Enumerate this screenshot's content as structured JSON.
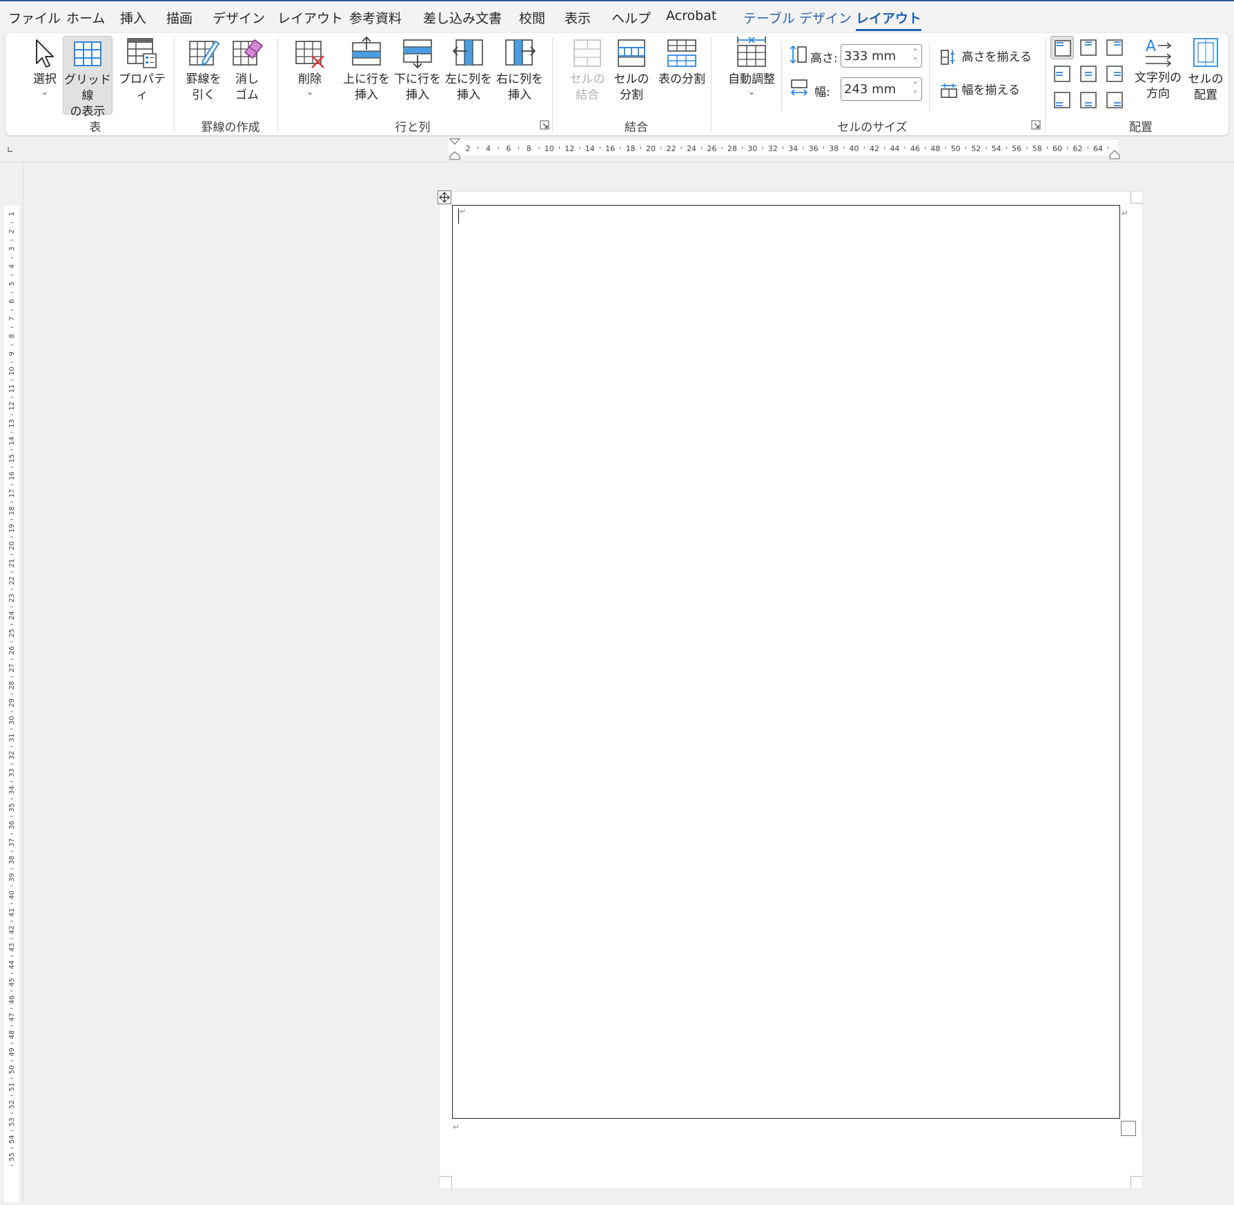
{
  "menu_tabs": [
    "ファイル",
    "ホーム",
    "挿入",
    "描画",
    "デザイン",
    "レイアウト",
    "参考資料",
    "差し込み文書",
    "校閲",
    "表示",
    "ヘルプ",
    "Acrobat",
    "テーブル デザイン",
    "レイアウト"
  ],
  "active_tab": "レイアウト",
  "groups": {
    "table": {
      "label": "表",
      "select": "選択",
      "gridlines": "グリッド線\nの表示",
      "properties": "プロパティ"
    },
    "draw": {
      "label": "罫線の作成",
      "draw_table": "罫線を\n引く",
      "eraser": "消し\nゴム"
    },
    "rows_cols": {
      "label": "行と列",
      "delete": "削除",
      "insert_above": "上に行を\n挿入",
      "insert_below": "下に行を\n挿入",
      "insert_left": "左に列を\n挿入",
      "insert_right": "右に列を\n挿入"
    },
    "merge": {
      "label": "結合",
      "merge_cells": "セルの\n結合",
      "split_cells": "セルの\n分割",
      "split_table": "表の分割"
    },
    "cell_size": {
      "label": "セルのサイズ",
      "autofit": "自動調整",
      "height_label": "高さ:",
      "height_value": "333 mm",
      "width_label": "幅:",
      "width_value": "243 mm",
      "distribute_rows": "高さを揃える",
      "distribute_cols": "幅を揃える"
    },
    "alignment": {
      "label": "配置",
      "text_direction": "文字列の\n方向",
      "cell_margins": "セルの\n配置"
    }
  },
  "colors": {
    "accent": "#1f5fb4",
    "icon_blue": "#2e86de",
    "icon_fill": "#4a9de0"
  },
  "ruler": {
    "horizontal_ticks": [
      "2",
      "4",
      "6",
      "8",
      "10",
      "12",
      "14",
      "16",
      "18",
      "20",
      "22",
      "24",
      "26",
      "28",
      "30",
      "32",
      "34",
      "36",
      "38",
      "40",
      "42",
      "44",
      "46",
      "48",
      "50",
      "52",
      "54",
      "56",
      "58",
      "60",
      "62",
      "64"
    ],
    "vertical_ticks": [
      "1",
      "2",
      "3",
      "4",
      "5",
      "6",
      "7",
      "8",
      "9",
      "10",
      "11",
      "12",
      "13",
      "14",
      "15",
      "16",
      "17",
      "18",
      "19",
      "20",
      "21",
      "22",
      "23",
      "24",
      "25",
      "26",
      "27",
      "28",
      "29",
      "30",
      "31",
      "32",
      "33",
      "34",
      "35",
      "36",
      "37",
      "38",
      "39",
      "40",
      "41",
      "42",
      "43",
      "44",
      "45",
      "46",
      "47",
      "48",
      "49",
      "50",
      "51",
      "52",
      "53",
      "54",
      "55"
    ]
  }
}
